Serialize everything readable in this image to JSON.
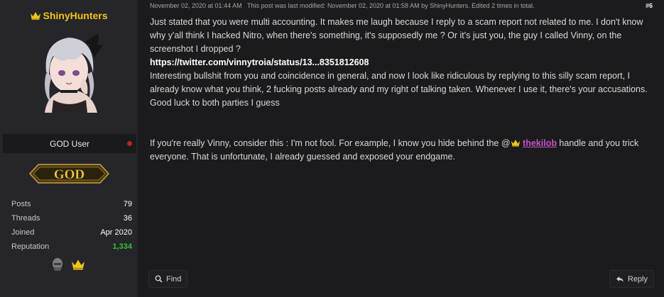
{
  "user": {
    "name": "ShinyHunters",
    "title": "GOD User",
    "rank_badge": "GOD",
    "stats": [
      {
        "label": "Posts",
        "value": "79"
      },
      {
        "label": "Threads",
        "value": "36"
      },
      {
        "label": "Joined",
        "value": "Apr 2020"
      },
      {
        "label": "Reputation",
        "value": "1,334"
      }
    ],
    "awards": [
      "helmet-icon",
      "crown-icon"
    ],
    "status_color": "#b52424",
    "name_color": "#f0c419"
  },
  "post": {
    "date": "November 02, 2020 at 01:44 AM",
    "edit_note": "This post was last modified: November 02, 2020 at 01:58 AM by ShinyHunters. Edited 2 times in total.",
    "number": "#6",
    "para1": "Just stated that you were multi accounting. It makes me laugh because I reply to a scam report not related to me. I don't know why y'all think I hacked Nitro, when there's something, it's supposedly me ? Or it's just you, the guy I called Vinny, on the screenshot I dropped ?",
    "link": "https://twitter.com/vinnytroia/status/13...8351812608",
    "para2": "Interesting bullshit from you and coincidence in general, and now I look like ridiculous by replying to this silly scam report, I already know what you think, 2 fucking posts already and my right of talking taken. Whenever I use it, there's your accusations.",
    "para3": "Good luck to both parties I guess",
    "para4_before": "If you're really Vinny, consider this : I'm not fool. For example, I know you hide behind the @",
    "mention": "thekilob",
    "para4_after": " handle and you trick everyone. That is unfortunate, I already guessed and exposed your endgame.",
    "mention_color": "#c653c6"
  },
  "actions": {
    "find_label": "Find",
    "reply_label": "Reply"
  }
}
